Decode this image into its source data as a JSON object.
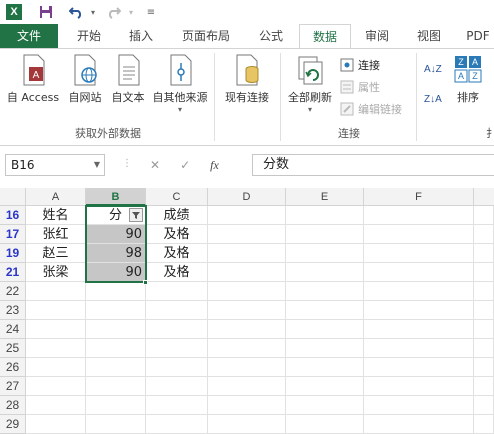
{
  "qat": {
    "excel_logo_text": "X",
    "icons": [
      "excel-logo-icon",
      "save-icon",
      "undo-icon",
      "redo-icon",
      "customize-icon"
    ]
  },
  "tabs": {
    "file": "文件",
    "items": [
      "开始",
      "插入",
      "页面布局",
      "公式",
      "数据",
      "审阅",
      "视图",
      "PDF"
    ],
    "active": "数据"
  },
  "ribbon": {
    "get_external": {
      "buttons": [
        "自 Access",
        "自网站",
        "自文本",
        "自其他来源"
      ],
      "label": "获取外部数据"
    },
    "existing_connections": "现有连接",
    "refresh_all": "全部刷新",
    "connections_group": {
      "items": [
        "连接",
        "属性",
        "编辑链接"
      ],
      "label": "连接"
    },
    "sort": "排序",
    "sort_az": "A↓Z",
    "sort_za": "Z↓A",
    "next_group_label_partial": "扌"
  },
  "formula_bar": {
    "name_box": "B16",
    "cancel": "✕",
    "enter": "✓",
    "fx": "fx",
    "content": "分数"
  },
  "sheet": {
    "columns": [
      "A",
      "B",
      "C",
      "D",
      "E",
      "F"
    ],
    "rows": [
      {
        "num": "16",
        "cells": [
          "姓名",
          "分",
          "成绩"
        ]
      },
      {
        "num": "17",
        "cells": [
          "张红",
          "90",
          "及格"
        ]
      },
      {
        "num": "19",
        "cells": [
          "赵三",
          "98",
          "及格"
        ]
      },
      {
        "num": "21",
        "cells": [
          "张梁",
          "90",
          "及格"
        ]
      },
      {
        "num": "22",
        "cells": [
          "",
          "",
          ""
        ]
      },
      {
        "num": "23",
        "cells": [
          "",
          "",
          ""
        ]
      },
      {
        "num": "24",
        "cells": [
          "",
          "",
          ""
        ]
      },
      {
        "num": "25",
        "cells": [
          "",
          "",
          ""
        ]
      },
      {
        "num": "26",
        "cells": [
          "",
          "",
          ""
        ]
      },
      {
        "num": "27",
        "cells": [
          "",
          "",
          ""
        ]
      },
      {
        "num": "28",
        "cells": [
          "",
          "",
          ""
        ]
      },
      {
        "num": "29",
        "cells": [
          "",
          "",
          ""
        ]
      }
    ]
  },
  "colors": {
    "accent": "#217346",
    "filtered_row": "#2b35c9",
    "selection_fill": "#c6c6c6"
  }
}
